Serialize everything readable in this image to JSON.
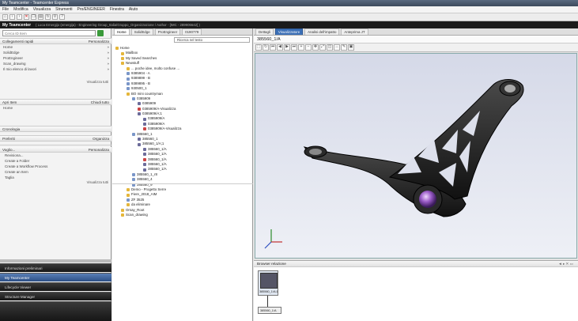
{
  "window": {
    "title": "My Teamcenter - Teamcenter Express"
  },
  "menu": [
    "File",
    "Modifica",
    "Visualizza",
    "Strumenti",
    "Pro/ENGINEER",
    "Finestra",
    "Aiuto"
  ],
  "appbar": {
    "title": "My Teamcenter",
    "context": "(  Luca Emergijo (emergija) - Engineering Group_Italia/Gruppo_Organizzazione / Author - [IMC - 289906642]  )"
  },
  "left": {
    "search_placeholder": "Cerca ID Item",
    "quick_links": {
      "title": "Collegamenti rapidi",
      "action": "Personalizza",
      "items": [
        "Home",
        "SolidEdge",
        "ProEngineer",
        "Scan_drawing",
        "Il mio elenco di lavori"
      ],
      "more": "Visualizza tutti"
    },
    "open_items": {
      "title": "Apri Item",
      "action": "Chiudi tutto",
      "items": [
        "Home"
      ]
    },
    "history": {
      "title": "Cronologia"
    },
    "favorites": {
      "title": "Preferiti",
      "action": "Organizza"
    },
    "want": {
      "title": "Voglio...",
      "action": "Personalizza",
      "items": [
        "Revisiona...",
        "Create a Folder",
        "Create a Workflow Process",
        "Create an Item",
        "Taglia"
      ],
      "more": "Visualizza tutti"
    },
    "nav": [
      "Informazioni preliminari",
      "My Teamcenter",
      "Lifecycle Viewer",
      "Structure Manager"
    ]
  },
  "mid": {
    "tabs": [
      "Home",
      "SolidEdge",
      "ProEngineer",
      "0190779"
    ],
    "search_label": "Ricerca nel testo",
    "tree": [
      {
        "label": "Home",
        "d": 0,
        "t": "fold"
      },
      {
        "label": "Mailbox",
        "d": 1,
        "t": "fold"
      },
      {
        "label": "My Saved Searches",
        "d": 1,
        "t": "fold"
      },
      {
        "label": "Newstuff",
        "d": 1,
        "t": "fold"
      },
      {
        "label": "... poche idee, molto confuse ...",
        "d": 2,
        "t": "fold"
      },
      {
        "label": "9385904 - A",
        "d": 2,
        "t": "item"
      },
      {
        "label": "9389899 - B",
        "d": 2,
        "t": "item"
      },
      {
        "label": "9389895 - B",
        "d": 2,
        "t": "item"
      },
      {
        "label": "930500_1",
        "d": 2,
        "t": "item"
      },
      {
        "label": "BO mini countryman",
        "d": 2,
        "t": "fold"
      },
      {
        "label": "0385909",
        "d": 3,
        "t": "item"
      },
      {
        "label": "0385909",
        "d": 4,
        "t": "rev"
      },
      {
        "label": "0385909/A-Visualizza",
        "d": 4,
        "t": "ds"
      },
      {
        "label": "0385909/A;1",
        "d": 4,
        "t": "rev"
      },
      {
        "label": "0385909/A",
        "d": 5,
        "t": "rev"
      },
      {
        "label": "0385909/A",
        "d": 5,
        "t": "rev"
      },
      {
        "label": "0385909/A-Visualizza",
        "d": 5,
        "t": "ds"
      },
      {
        "label": "385560_1",
        "d": 3,
        "t": "item"
      },
      {
        "label": "385560_1",
        "d": 4,
        "t": "rev"
      },
      {
        "label": "385560_1/A;1",
        "d": 4,
        "t": "rev"
      },
      {
        "label": "385560_1/A",
        "d": 5,
        "t": "rev"
      },
      {
        "label": "385560_1/A",
        "d": 5,
        "t": "rev"
      },
      {
        "label": "385560_1/A",
        "d": 5,
        "t": "ds"
      },
      {
        "label": "385560_1/A",
        "d": 5,
        "t": "rev"
      },
      {
        "label": "385560_1/A",
        "d": 5,
        "t": "rev"
      },
      {
        "label": "385560_1_r8",
        "d": 3,
        "t": "item"
      },
      {
        "label": "385560_4",
        "d": 3,
        "t": "item"
      },
      {
        "label": "385560_9",
        "d": 3,
        "t": "item"
      },
      {
        "label": "Demo - Progetto Serre",
        "d": 2,
        "t": "fold"
      },
      {
        "label": "Fiere_2018_AIM",
        "d": 2,
        "t": "fold"
      },
      {
        "label": "ZF 3525",
        "d": 2,
        "t": "item"
      },
      {
        "label": "da eliminare",
        "d": 2,
        "t": "fold"
      },
      {
        "label": "Orsay_Root",
        "d": 1,
        "t": "fold"
      },
      {
        "label": "Scan_drawing",
        "d": 1,
        "t": "fold"
      }
    ]
  },
  "right": {
    "tabs": [
      "Dettagli",
      "Visualizzatore",
      "Analisi dell'impatto",
      "Anteprima JT"
    ],
    "viewer_title": "385560_1/A",
    "relations_title": "Browser relazione",
    "node1": "385560_1/A;1",
    "node2": "385560_1/A"
  }
}
